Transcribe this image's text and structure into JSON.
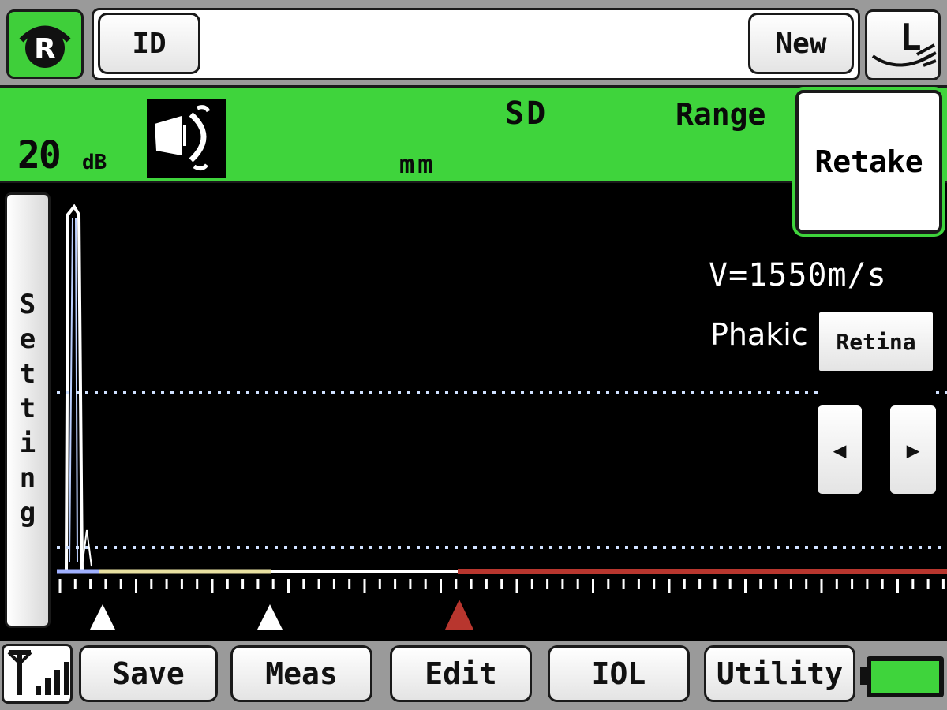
{
  "top_bar": {
    "logo_letter": "R",
    "id_label": "ID",
    "new_label": "New"
  },
  "status": {
    "gain_value": "20",
    "gain_unit": "dB",
    "sd_label": "SD",
    "range_label": "Range",
    "unit_label": "mm",
    "retake_label": "Retake",
    "probe_icon": "probe-eye-icon"
  },
  "scan": {
    "setting_label": "Setting",
    "velocity": "V=1550m/s",
    "lens_state": "Phakic",
    "retina_label": "Retina",
    "left_arrow": "◀",
    "right_arrow": "▶"
  },
  "bottom_bar": {
    "save_label": "Save",
    "meas_label": "Meas",
    "edit_label": "Edit",
    "iol_label": "IOL",
    "utility_label": "Utility"
  },
  "colors": {
    "accent_green": "#3fd43c",
    "gate_red": "#b8362e",
    "gate_yellow": "#e8e0a0",
    "gate_white": "#ffffff",
    "dotted_line": "#cfe0ff"
  }
}
